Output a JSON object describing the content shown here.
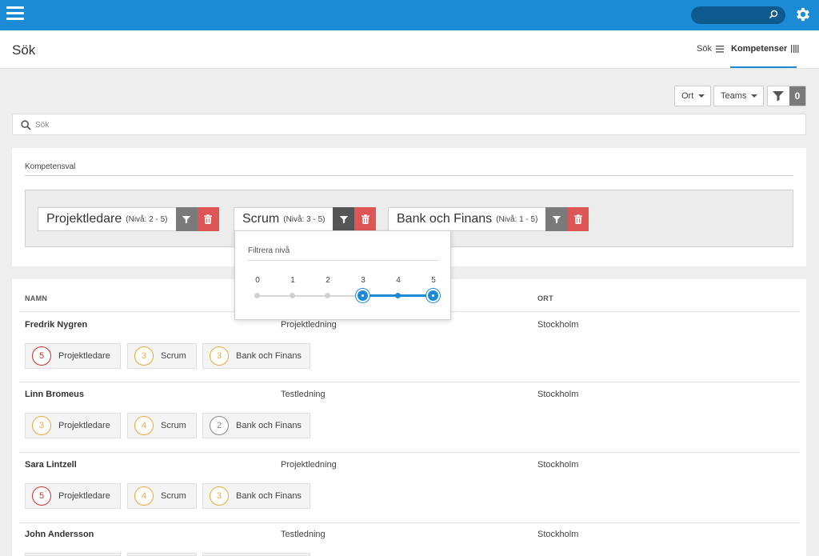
{
  "topbar": {
    "search_placeholder": ""
  },
  "header": {
    "title": "Sök",
    "tabs": [
      {
        "label": "Sök"
      },
      {
        "label": "Kompetenser"
      }
    ]
  },
  "filters": {
    "ort_label": "Ort",
    "teams_label": "Teams",
    "count": "0"
  },
  "search": {
    "placeholder": "Sök"
  },
  "competence": {
    "title": "Kompetensval",
    "chips": [
      {
        "name": "Projektledare",
        "level": "(Nivå: 2 - 5)"
      },
      {
        "name": "Scrum",
        "level": "(Nivå: 3 - 5)"
      },
      {
        "name": "Bank och Finans",
        "level": "(Nivå: 1 - 5)"
      }
    ]
  },
  "popover": {
    "title": "Filtrera nivå",
    "levels": [
      "0",
      "1",
      "2",
      "3",
      "4",
      "5"
    ],
    "range_min": 3,
    "range_max": 5
  },
  "table": {
    "headers": {
      "name": "NAMN",
      "city": "ORT"
    },
    "rows": [
      {
        "name": "Fredrik Nygren",
        "dept": "Projektledning",
        "city": "Stockholm",
        "tags": [
          {
            "level": "5",
            "name": "Projektledare",
            "color": "#d0302a"
          },
          {
            "level": "3",
            "name": "Scrum",
            "color": "#e8a93a"
          },
          {
            "level": "3",
            "name": "Bank och Finans",
            "color": "#e8a93a"
          }
        ]
      },
      {
        "name": "Linn Bromeus",
        "dept": "Testledning",
        "city": "Stockholm",
        "tags": [
          {
            "level": "3",
            "name": "Projektledare",
            "color": "#e8a93a"
          },
          {
            "level": "4",
            "name": "Scrum",
            "color": "#e8a93a"
          },
          {
            "level": "2",
            "name": "Bank och Finans",
            "color": "#888888"
          }
        ]
      },
      {
        "name": "Sara Lintzell",
        "dept": "Projektledning",
        "city": "Stockholm",
        "tags": [
          {
            "level": "5",
            "name": "Projektledare",
            "color": "#d0302a"
          },
          {
            "level": "4",
            "name": "Scrum",
            "color": "#e8a93a"
          },
          {
            "level": "3",
            "name": "Bank och Finans",
            "color": "#e8a93a"
          }
        ]
      },
      {
        "name": "John Andersson",
        "dept": "Testledning",
        "city": "Stockholm",
        "tags": []
      }
    ]
  },
  "colors": {
    "accent": "#1b8bd6",
    "delete": "#de5555",
    "filter": "#7a7a7a"
  }
}
